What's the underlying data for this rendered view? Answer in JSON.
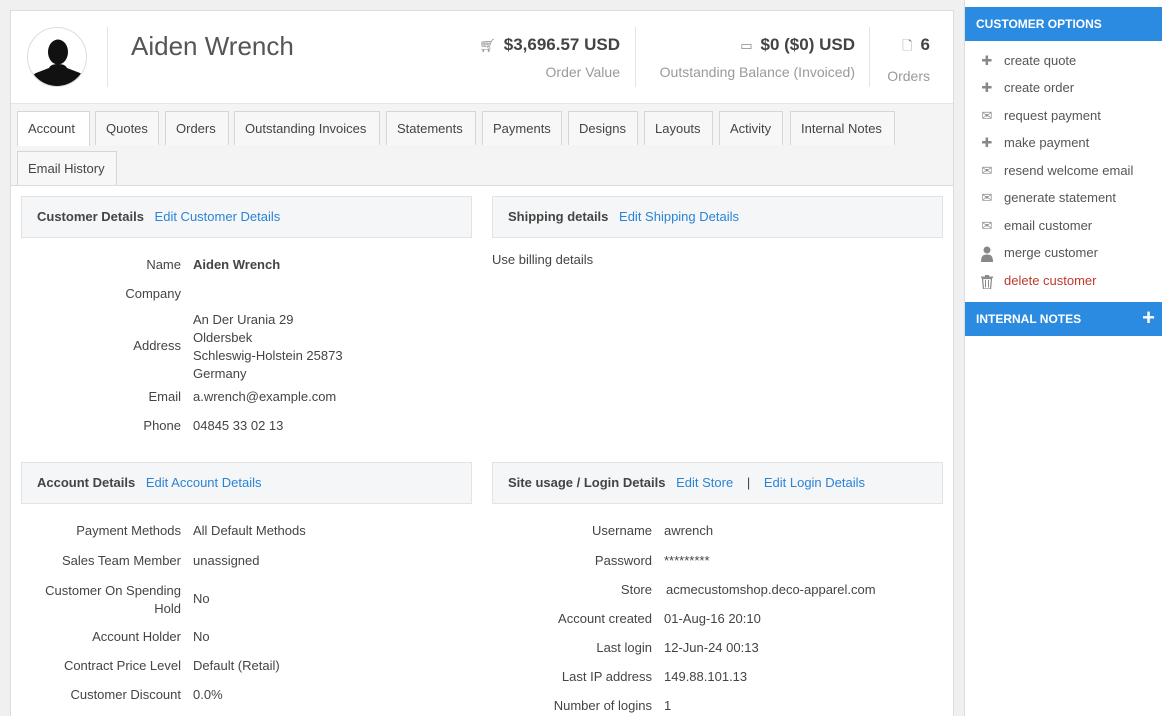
{
  "customer": {
    "name": "Aiden Wrench"
  },
  "stats": [
    {
      "icon": "cart-icon",
      "value": "$3,696.57 USD",
      "label": "Order Value"
    },
    {
      "icon": "folder-icon",
      "value": "$0 ($0) USD",
      "label": "Outstanding Balance (Invoiced)"
    },
    {
      "icon": "document-icon",
      "value": "6",
      "label": "Orders"
    }
  ],
  "tabs": [
    "Account",
    "Quotes",
    "Orders",
    "Outstanding Invoices",
    "Statements",
    "Payments",
    "Designs",
    "Layouts",
    "Activity",
    "Internal Notes",
    "Email History"
  ],
  "customer_details": {
    "title": "Customer Details",
    "edit_link": "Edit Customer Details",
    "name_label": "Name",
    "name_value": "Aiden Wrench",
    "company_label": "Company",
    "company_value": "",
    "address_label": "Address",
    "address_lines": [
      "An Der Urania 29",
      "Oldersbek",
      "Schleswig-Holstein 25873",
      "Germany"
    ],
    "email_label": "Email",
    "email_value": "a.wrench@example.com",
    "phone_label": "Phone",
    "phone_value": "04845 33 02 13"
  },
  "shipping_details": {
    "title": "Shipping details",
    "edit_link": "Edit Shipping Details",
    "text": "Use billing details"
  },
  "account_details": {
    "title": "Account Details",
    "edit_link": "Edit Account Details",
    "rows": [
      {
        "label": "Payment Methods",
        "value": "All Default Methods"
      },
      {
        "label": "Sales Team Member",
        "value": "unassigned"
      },
      {
        "label_line1": "Customer On Spending",
        "label_line2": "Hold",
        "value": "No"
      },
      {
        "label": "Account Holder",
        "value": "No"
      },
      {
        "label": "Contract Price Level",
        "value": "Default (Retail)"
      },
      {
        "label": "Customer Discount",
        "value": "0.0%"
      }
    ]
  },
  "site_usage": {
    "title": "Site usage / Login Details",
    "edit_store": "Edit Store",
    "separator": "|",
    "edit_login": "Edit Login Details",
    "rows": [
      {
        "label": "Username",
        "value": "awrench"
      },
      {
        "label": "Password",
        "value": "*********"
      },
      {
        "label": "Store",
        "value": "acmecustomshop.deco-apparel.com"
      },
      {
        "label": "Account created",
        "value": "01-Aug-16 20:10"
      },
      {
        "label": "Last login",
        "value": "12-Jun-24 00:13"
      },
      {
        "label": "Last IP address",
        "value": "149.88.101.13"
      },
      {
        "label": "Number of logins",
        "value": "1"
      }
    ]
  },
  "sidebar": {
    "options_title": "CUSTOMER OPTIONS",
    "items": [
      {
        "icon": "plus-icon",
        "label": "create quote"
      },
      {
        "icon": "plus-icon",
        "label": "create order"
      },
      {
        "icon": "envelope-icon",
        "label": "request payment"
      },
      {
        "icon": "plus-icon",
        "label": "make payment"
      },
      {
        "icon": "envelope-icon",
        "label": "resend welcome email"
      },
      {
        "icon": "envelope-icon",
        "label": "generate statement"
      },
      {
        "icon": "envelope-icon",
        "label": "email customer"
      },
      {
        "icon": "person-icon",
        "label": "merge customer"
      },
      {
        "icon": "trash-icon",
        "label": "delete customer"
      }
    ],
    "notes_title": "INTERNAL NOTES"
  },
  "colors": {
    "accent": "#2b8be0",
    "link": "#2b83d6",
    "danger": "#c0392b"
  }
}
